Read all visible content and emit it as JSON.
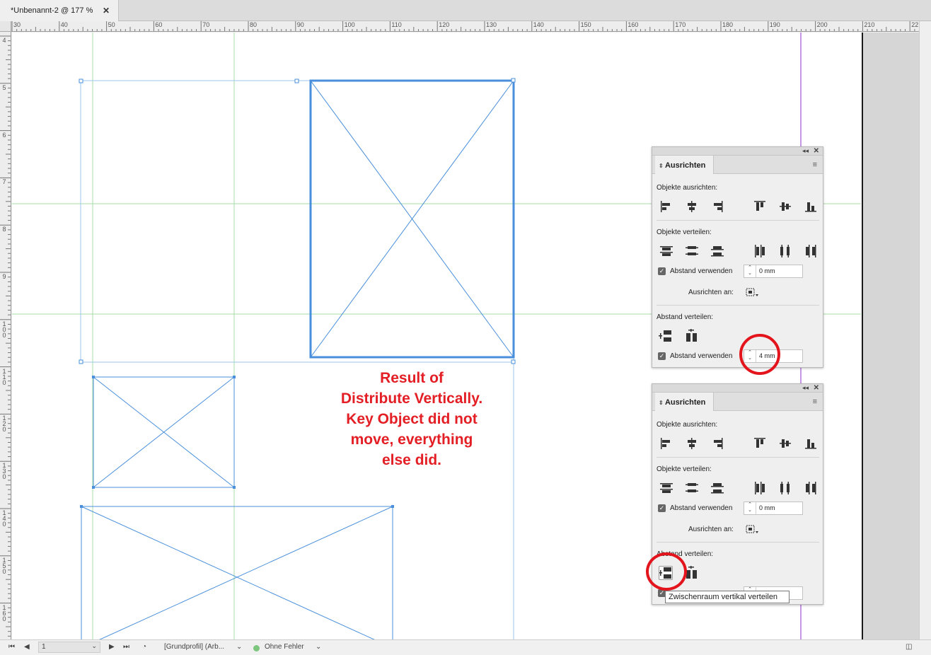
{
  "document_tab": {
    "title": "*Unbenannt-2 @ 177 %",
    "close_glyph": "✕"
  },
  "rulers": {
    "horizontal": [
      "30",
      "40",
      "50",
      "60",
      "70",
      "80",
      "90",
      "100",
      "110",
      "120",
      "130",
      "140",
      "150",
      "160",
      "170",
      "180",
      "190",
      "200",
      "210",
      "22"
    ],
    "vertical": [
      "4",
      "5",
      "6",
      "7",
      "8",
      "9",
      "100",
      "110",
      "120",
      "130",
      "140",
      "150",
      "160"
    ]
  },
  "annotation": {
    "text": "Result of\nDistribute Vertically.\nKey Object did not\nmove, everything\nelse did.",
    "color": "#e31e24"
  },
  "panels": [
    {
      "tab_title": "Ausrichten",
      "collapse_glyph": "◂◂",
      "close_glyph": "✕",
      "menu_glyph": "≡",
      "section_align": "Objekte ausrichten:",
      "section_distribute": "Objekte verteilen:",
      "use_spacing_1": "Abstand verwenden",
      "spacing_1_value": "0 mm",
      "align_to_label": "Ausrichten an:",
      "section_space": "Abstand verteilen:",
      "use_spacing_2": "Abstand verwenden",
      "spacing_2_value": "4 mm"
    },
    {
      "tab_title": "Ausrichten",
      "collapse_glyph": "◂◂",
      "close_glyph": "✕",
      "menu_glyph": "≡",
      "section_align": "Objekte ausrichten:",
      "section_distribute": "Objekte verteilen:",
      "use_spacing_1": "Abstand verwenden",
      "spacing_1_value": "0 mm",
      "align_to_label": "Ausrichten an:",
      "section_space": "Abstand verteilen:"
    }
  ],
  "tooltip": {
    "text": "Zwischenraum vertikal verteilen"
  },
  "statusbar": {
    "page_number": "1",
    "profile": "[Grundprofil] (Arb...",
    "preflight": "Ohne Fehler"
  },
  "colors": {
    "frame_blue": "#4a8fdb",
    "guide_green": "#a8dca8",
    "margin_purple": "#8b2fc9",
    "callout_red": "#e3141b"
  }
}
